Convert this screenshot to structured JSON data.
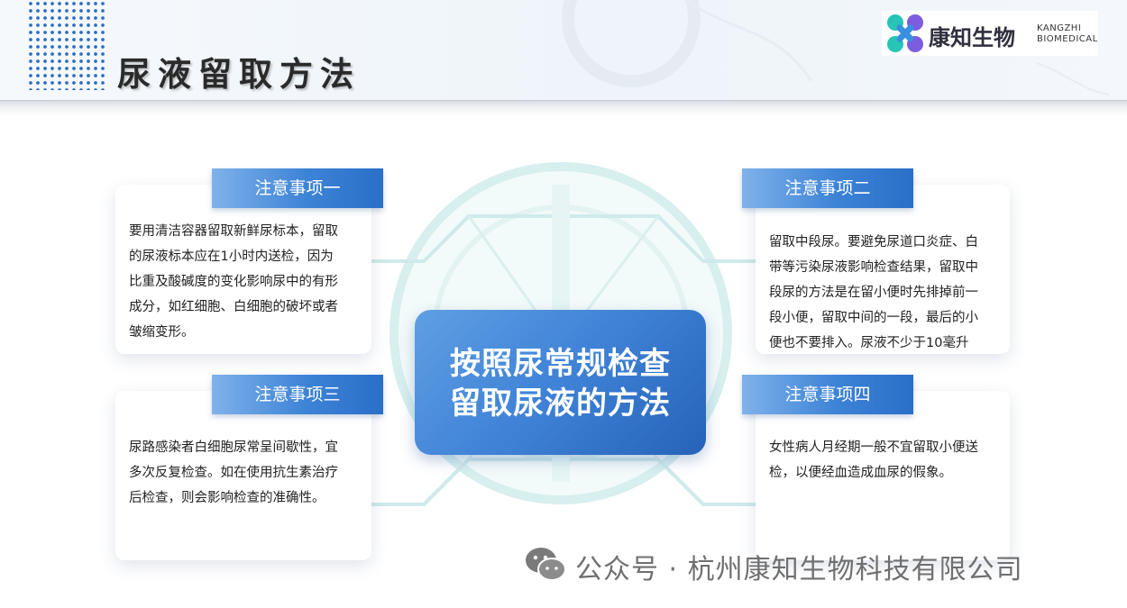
{
  "header": {
    "title": "尿液留取方法",
    "logo": {
      "name_cn": "康知生物",
      "name_en_line1": "KANGZHI",
      "name_en_line2": "BIOMEDICAL",
      "colors": [
        "#27c4b8",
        "#7d5ce0",
        "#3a8fe0"
      ]
    }
  },
  "center": {
    "line1": "按照尿常规检查",
    "line2": "留取尿液的方法"
  },
  "notes": [
    {
      "title": "注意事项一",
      "lines": [
        "要用清洁容器留取新鲜尿标本，留取",
        "的尿液标本应在1小时内送检，因为",
        "比重及酸碱度的变化影响尿中的有形",
        "成分，如红细胞、白细胞的破坏或者",
        "皱缩变形。"
      ]
    },
    {
      "title": "注意事项二",
      "lines": [
        "留取中段尿。要避免尿道口炎症、白",
        "带等污染尿液影响检查结果，留取中",
        "段尿的方法是在留小便时先排掉前一",
        "段小便，留取中间的一段，最后的小",
        "便也不要排入。尿液不少于10毫升"
      ]
    },
    {
      "title": "注意事项三",
      "lines": [
        "尿路感染者白细胞尿常呈间歇性，宜",
        "多次反复检查。如在使用抗生素治疗",
        "后检查，则会影响检查的准确性。"
      ]
    },
    {
      "title": "注意事项四",
      "lines": [
        "女性病人月经期一般不宜留取小便送",
        "检，以便经血造成血尿的假象。"
      ]
    }
  ],
  "watermark": {
    "icon": "wechat-icon",
    "text": "公众号 · 杭州康知生物科技有限公司"
  },
  "colors": {
    "accent_blue": "#3d83d6",
    "tab_light": "#7fb2ea",
    "teal_lines": "#cfeaea",
    "title_text": "#2a2a2a"
  }
}
